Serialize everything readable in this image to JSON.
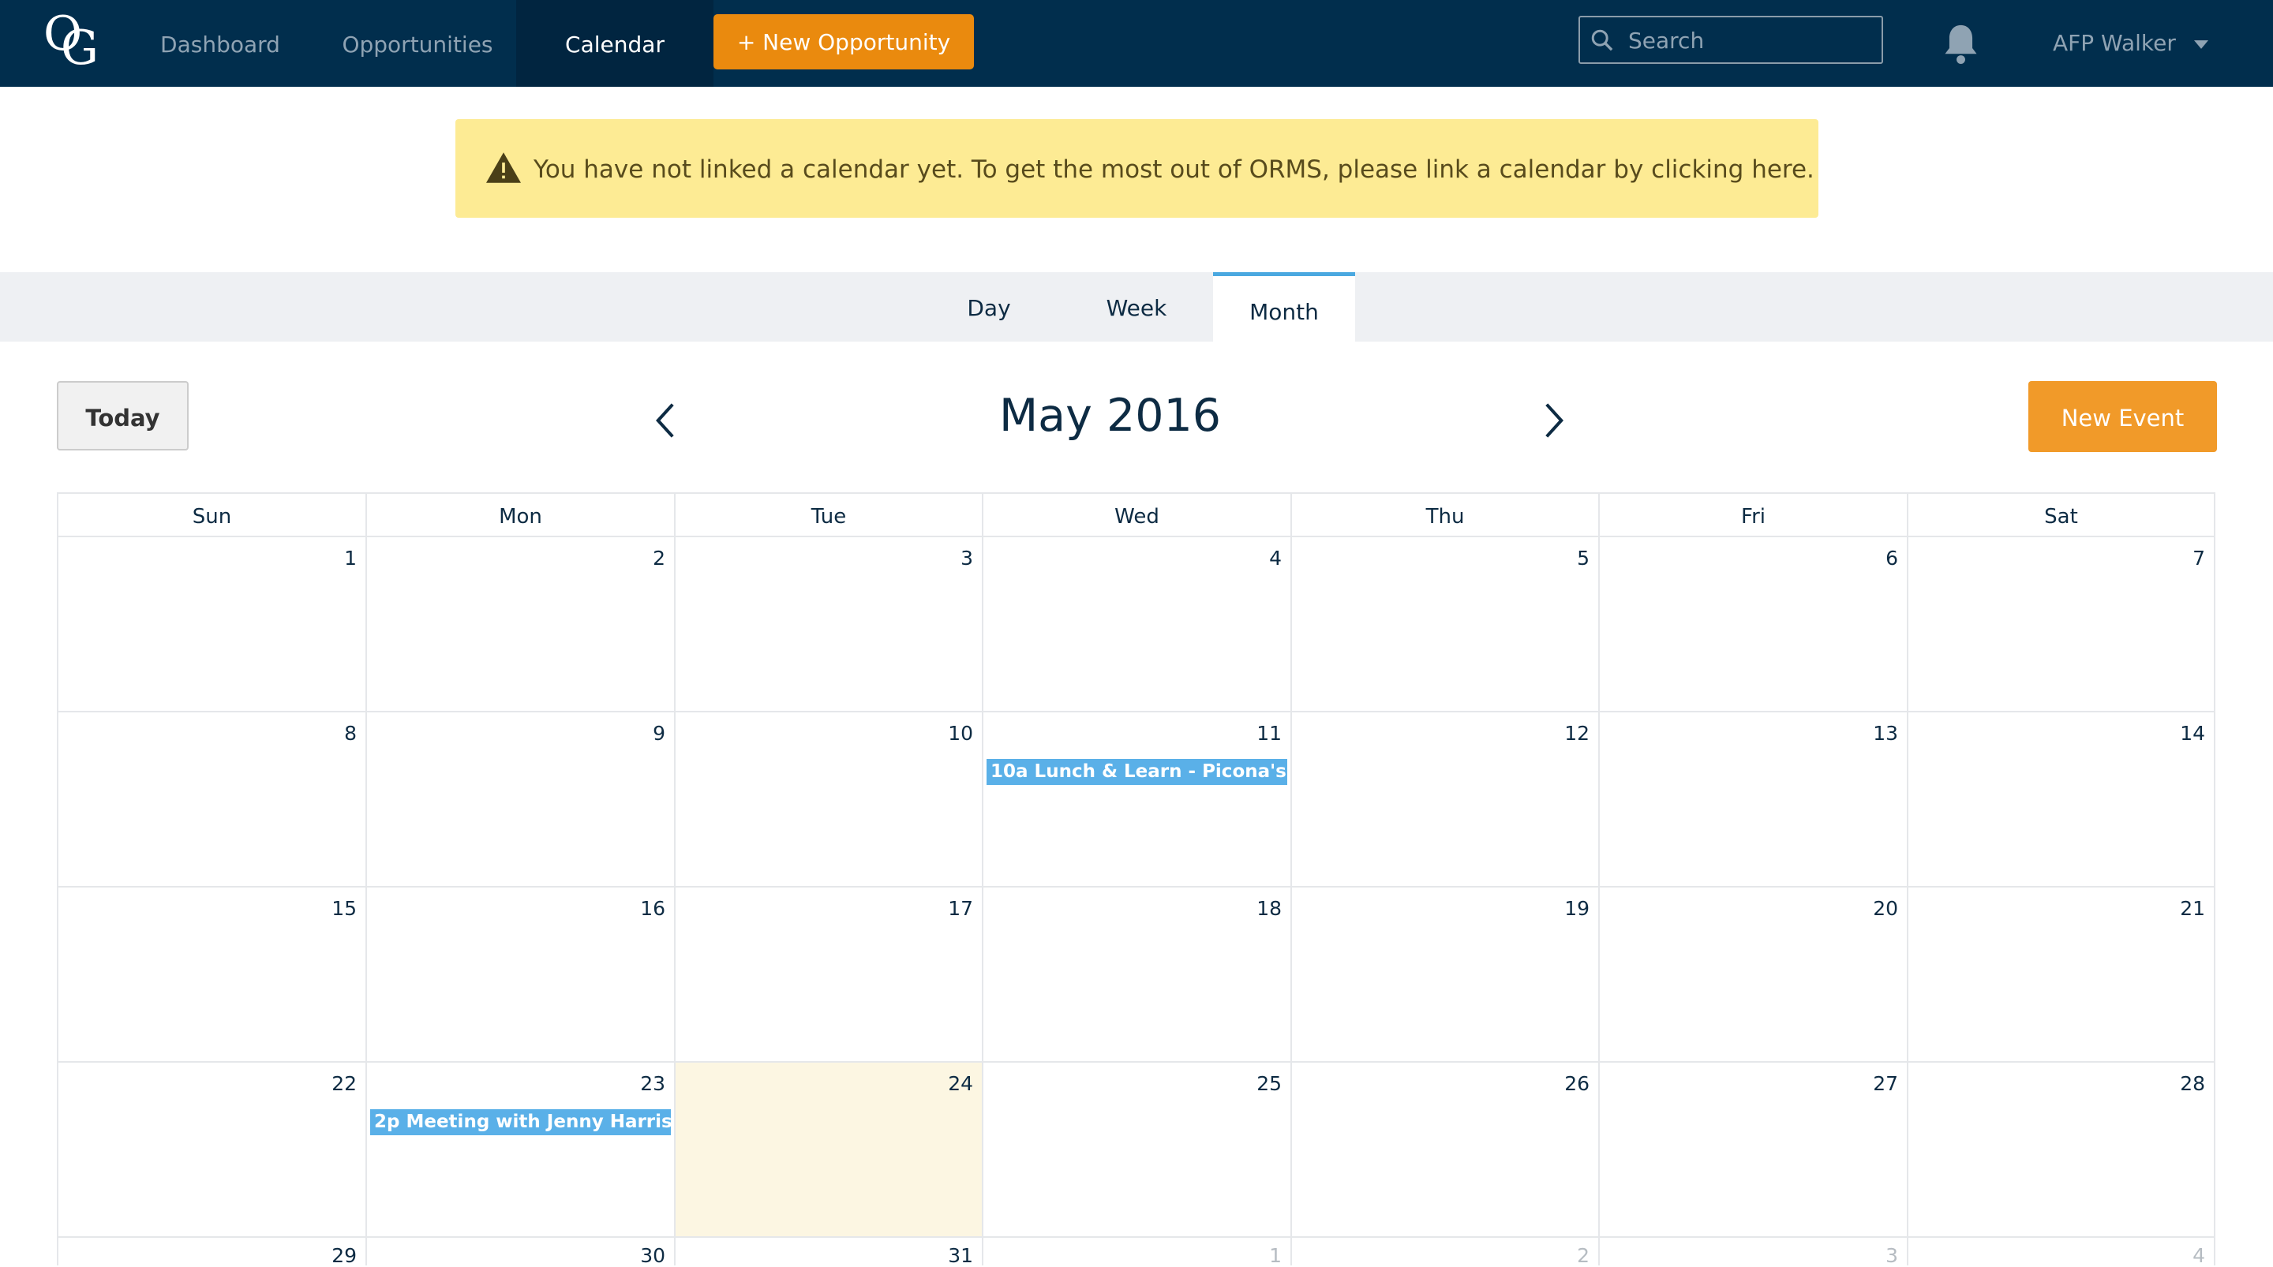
{
  "nav": {
    "logo_text": "OG",
    "links": [
      {
        "label": "Dashboard"
      },
      {
        "label": "Opportunities"
      },
      {
        "label": "Calendar",
        "active": true
      }
    ],
    "new_opportunity_label": "+ New Opportunity",
    "search_placeholder": "Search",
    "user_name": "AFP Walker",
    "icons": [
      "search-icon",
      "bell-icon",
      "caret-down-icon"
    ]
  },
  "alert": {
    "text": "You have not linked a calendar yet. To get the most out of ORMS, please link a calendar by clicking here.",
    "icon": "warning-icon"
  },
  "view_tabs": [
    {
      "label": "Day"
    },
    {
      "label": "Week"
    },
    {
      "label": "Month",
      "active": true
    }
  ],
  "toolbar": {
    "today_label": "Today",
    "month_title": "May 2016",
    "new_event_label": "New Event"
  },
  "colors": {
    "nav_bg": "#012e4d",
    "accent_orange": "#ea8a0e",
    "event_blue": "#5ab0e8",
    "today_bg": "#fcf6e2",
    "alert_bg": "#fdeb94"
  },
  "calendar": {
    "weekdays": [
      "Sun",
      "Mon",
      "Tue",
      "Wed",
      "Thu",
      "Fri",
      "Sat"
    ],
    "today": 24,
    "weeks": [
      [
        "1",
        "2",
        "3",
        "4",
        "5",
        "6",
        "7"
      ],
      [
        "8",
        "9",
        "10",
        "11",
        "12",
        "13",
        "14"
      ],
      [
        "15",
        "16",
        "17",
        "18",
        "19",
        "20",
        "21"
      ],
      [
        "22",
        "23",
        "24",
        "25",
        "26",
        "27",
        "28"
      ],
      [
        "29",
        "30",
        "31",
        "1",
        "2",
        "3",
        "4"
      ]
    ],
    "events": [
      {
        "week": 1,
        "day": 3,
        "label": "10a Lunch & Learn - Picona's"
      },
      {
        "week": 3,
        "day": 1,
        "label": "2p Meeting with Jenny Harris"
      }
    ]
  }
}
